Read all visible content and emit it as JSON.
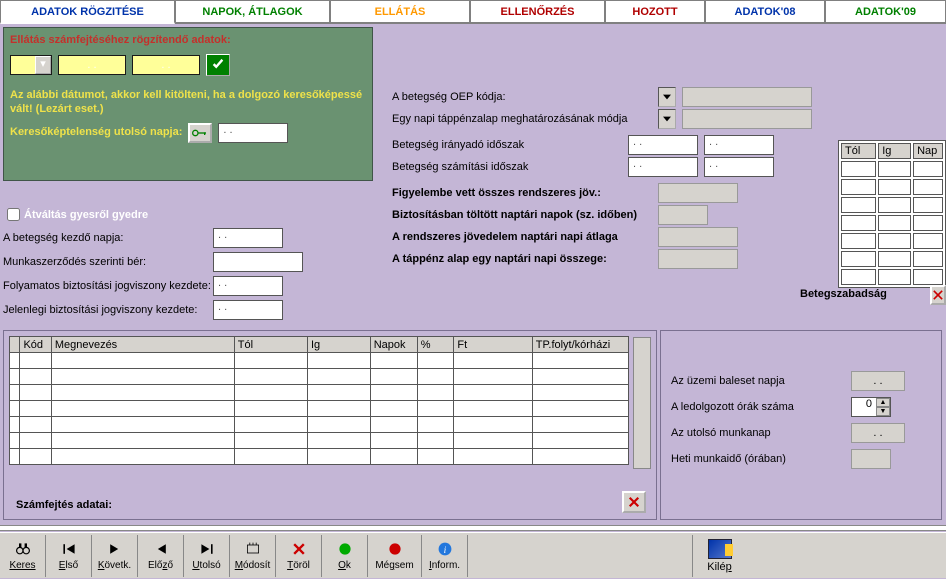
{
  "tabs": {
    "t1": "ADATOK RÖGZITÉSE",
    "t2": "NAPOK, ÁTLAGOK",
    "t3": "ELLÁTÁS",
    "t4": "ELLENŐRZÉS",
    "t5": "HOZOTT",
    "t6": "ADATOK'08",
    "t7": "ADATOK'09"
  },
  "green": {
    "title": "Ellátás számfejtéséhez rögzítendő adatok:",
    "combo1_val": "",
    "yel2_val": "  .   .",
    "yel3_val": "  .   .",
    "note1": "Az alábbi dátumot, akkor kell kitölteni, ha a dolgozó keresőképessé vált! (Lezárt eset.)",
    "last_day_label": "Keresőképtelenség utolsó napja:",
    "last_day_val": "  .   ."
  },
  "midleft": {
    "atvaltas": "Átváltás gyesről gyedre",
    "beteg_kezdo": "A betegség kezdő napja:",
    "beteg_kezdo_val": "  .   .",
    "munka_ber": "Munkaszerződés szerinti bér:",
    "munka_ber_val": "",
    "folyamatos": "Folyamatos biztosítási jogviszony kezdete:",
    "folyamatos_val": "  .   .",
    "jelenlegi": "Jelenlegi biztosítási jogviszony kezdete:",
    "jelenlegi_val": "  .   ."
  },
  "right": {
    "oep_label": "A betegség OEP kódja:",
    "oep_val": "",
    "tapalap_label": "Egy napi táppénzalap meghatározásának módja",
    "tapalap_val": "",
    "iranyado": "Betegség irányadó időszak",
    "iran_from": "  .   .",
    "iran_to": "  .   .",
    "szamitasi": "Betegség számítási időszak",
    "szam_from": "  .   .",
    "szam_to": "  .   .",
    "figyelembe": "Figyelembe vett összes rendszeres jöv.:",
    "fig_val": "",
    "biztositas": "Biztosításban töltött naptári napok (sz. időben)",
    "bizt_val": "",
    "rendszeres": "A rendszeres jövedelem naptári napi átlaga",
    "rend_val": "",
    "tappenz_alap": "A táppénz alap egy naptári napi összege:",
    "tp_val": ""
  },
  "small_grid": {
    "h1": "Tól",
    "h2": "Ig",
    "h3": "Nap"
  },
  "betegszabadsag": "Betegszabadság",
  "grid": {
    "kod": "Kód",
    "megnev": "Megnevezés",
    "tol": "Tól",
    "ig": "Ig",
    "napok": "Napok",
    "szaz": "%",
    "ft": "Ft",
    "tp": "TP.folyt/kórházi"
  },
  "szamfejtes_adatai": "Számfejtés adatai:",
  "lower_right": {
    "uzemi": "Az üzemi baleset napja",
    "uzemi_val": "  .   .",
    "orak": "A ledolgozott órák száma",
    "orak_val": "0",
    "utolso": "Az utolsó munkanap",
    "utolso_val": "  .   .",
    "heti": "Heti munkaidő (órában)",
    "heti_val": ""
  },
  "toolbar": {
    "keres": "Keres",
    "elso": "Első",
    "kovetk": "Követk.",
    "elozo": "Előző",
    "utolso": "Utolsó",
    "modosit": "Módosít",
    "torol": "Töröl",
    "ok": "Ok",
    "megsem": "Mégsem",
    "inform": "Inform.",
    "kilep": "Kilép"
  }
}
